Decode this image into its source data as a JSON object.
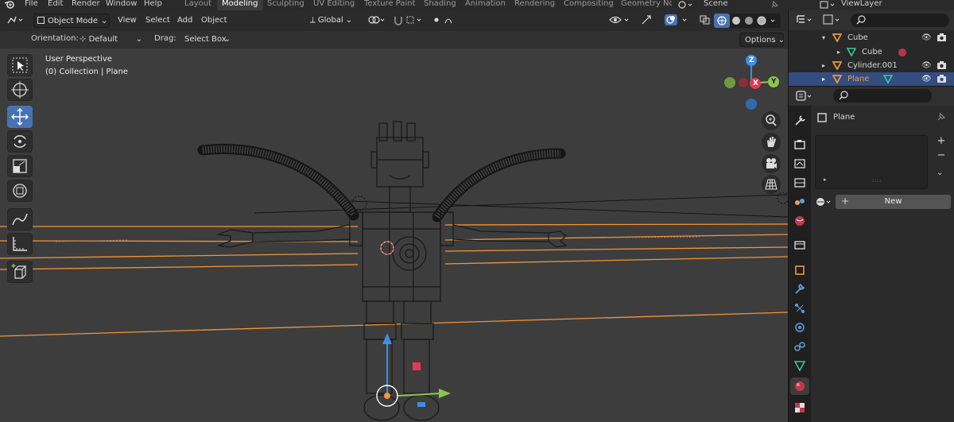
{
  "menu": {
    "file": "File",
    "edit": "Edit",
    "render": "Render",
    "window": "Window",
    "help": "Help"
  },
  "workspaces": [
    "Layout",
    "Modeling",
    "Sculpting",
    "UV Editing",
    "Texture Paint",
    "Shading",
    "Animation",
    "Rendering",
    "Compositing",
    "Geometry Noc"
  ],
  "active_workspace": "Modeling",
  "scene": "Scene",
  "view_layer": "ViewLayer",
  "viewport_header": {
    "mode": "Object Mode",
    "view": "View",
    "select": "Select",
    "add": "Add",
    "object": "Object",
    "transform_orientation": "Global"
  },
  "tool_settings": {
    "orientation_label": "Orientation:",
    "orientation_value": "Default",
    "drag_label": "Drag:",
    "drag_value": "Select Box",
    "options": "Options"
  },
  "overlay_text": {
    "perspective": "User Perspective",
    "collection": "(0) Collection | Plane"
  },
  "gizmo": {
    "z": "Z",
    "x": "X",
    "y": "Y"
  },
  "outliner": {
    "items": [
      {
        "name": "Cube",
        "type": "object",
        "selected": false
      },
      {
        "name": "Cube",
        "type": "mesh",
        "selected": false
      },
      {
        "name": "Cylinder.001",
        "type": "object",
        "selected": false
      },
      {
        "name": "Plane",
        "type": "object",
        "selected": true
      }
    ]
  },
  "properties": {
    "object_name": "Plane",
    "new_button": "New",
    "add": "+",
    "remove": "−",
    "dots": "::::"
  },
  "colors": {
    "accent": "#4772b3",
    "orange_wire": "#f0953a",
    "header": "#2b2b2b",
    "viewport": "#3d3d3d",
    "x_axis": "#e8394e",
    "y_axis": "#8cc64d",
    "z_axis": "#3d8ee8"
  }
}
